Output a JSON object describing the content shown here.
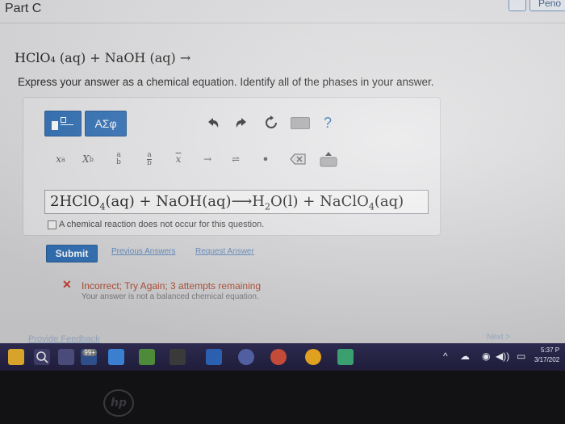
{
  "header": {
    "part_label": "Part C",
    "top_buttons": [
      "",
      "Peno"
    ]
  },
  "question": {
    "equation": "HClO₄ (aq) + NaOH (aq) →",
    "instruction": "Express your answer as a chemical equation. Identify all of the phases in your answer."
  },
  "toolbar": {
    "symbols_label": "ΑΣφ",
    "help_label": "?",
    "tools": [
      "x^a",
      "X_b",
      "a/b",
      "a/b",
      "x̄",
      "→",
      "⇌",
      "•"
    ]
  },
  "answer": {
    "value_parts": [
      {
        "text": "2HClO"
      },
      {
        "sub": "4"
      },
      {
        "text": "(aq) + NaOH(aq)⟶H"
      },
      {
        "sub": "2"
      },
      {
        "text": "O(l) + NaClO"
      },
      {
        "sub": "4"
      },
      {
        "text": "(aq)"
      }
    ],
    "no_reaction_label": "A chemical reaction does not occur for this question."
  },
  "actions": {
    "submit_label": "Submit",
    "previous_answers_label": "Previous Answers",
    "request_answer_label": "Request Answer"
  },
  "feedback": {
    "title": "Incorrect; Try Again; 3 attempts remaining",
    "detail": "Your answer is not a balanced chemical equation.",
    "provide_feedback_label": "Provide Feedback",
    "next_label": "Next >"
  },
  "taskbar": {
    "badge": "99+",
    "clock_time": "5:37 P",
    "clock_date": "3/17/202"
  },
  "brand": "hp",
  "colors": {
    "accent": "#2f6fb6",
    "error": "#c93a2e",
    "link": "#5d88bd"
  }
}
